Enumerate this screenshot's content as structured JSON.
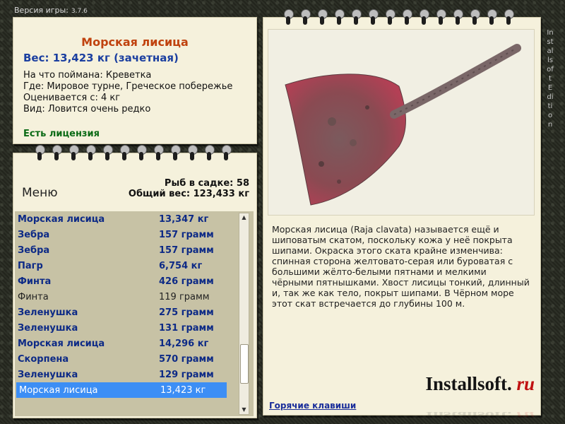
{
  "app": {
    "version_label": "Версия игры:",
    "version": "3.7.6"
  },
  "fish_card": {
    "title": "Морская лисица",
    "weight": "Вес: 13,423 кг (зачетная)",
    "bait": "На что поймана: Креветка",
    "location": "Где: Мировое турне, Греческое побережье",
    "valued_from": "Оценивается с: 4 кг",
    "rarity": "Вид: Ловится очень редко",
    "license": "Есть лицензия"
  },
  "catch_list": {
    "menu_label": "Меню",
    "fish_in_keepnet": "Рыб в садке: 58",
    "total_weight": "Общий вес: 123,433 кг",
    "rows": [
      {
        "name": "Морская лисица",
        "weight": "13,347 кг"
      },
      {
        "name": "Зебра",
        "weight": "157 грамм"
      },
      {
        "name": "Зебра",
        "weight": "157 грамм"
      },
      {
        "name": "Пагр",
        "weight": "6,754 кг"
      },
      {
        "name": "Финта",
        "weight": "426 грамм"
      },
      {
        "name": "Финта",
        "weight": "119 грамм"
      },
      {
        "name": "Зеленушка",
        "weight": "275 грамм"
      },
      {
        "name": "Зеленушка",
        "weight": "131 грамм"
      },
      {
        "name": "Морская лисица",
        "weight": "14,296 кг"
      },
      {
        "name": "Скорпена",
        "weight": "570 грамм"
      },
      {
        "name": "Зеленушка",
        "weight": "129 грамм"
      },
      {
        "name": "Морская лисица",
        "weight": "13,423 кг"
      }
    ],
    "scroll_position": 0.85
  },
  "detail": {
    "description": "Морская лисица (Raja clavata) называется ещё и шиповатым скатом, поскольку кожа у неё покрыта шипами. Окраска этого ската крайне изменчива: спинная сторона желтовато-серая или буроватая с большими жёлто-белыми пятнами и мелкими чёрными пятнышками. Хвост лисицы тонкий, длинный и, так же как тело, покрыт шипами. В Чёрном море этот скат встречается до глубины 100 м.",
    "hotkeys_link": "Горячие клавиши",
    "logo_main": "Installsoft.",
    "logo_tld": "ru"
  },
  "side_watermark": "Installsoft Edition",
  "colors": {
    "paper": "#f5f1dc",
    "list_bg": "#c7c2a5",
    "selected_row": "#3c8ef5",
    "title_orange": "#c0420e",
    "weight_blue": "#1b3fa0",
    "license_green": "#0a6a15"
  }
}
